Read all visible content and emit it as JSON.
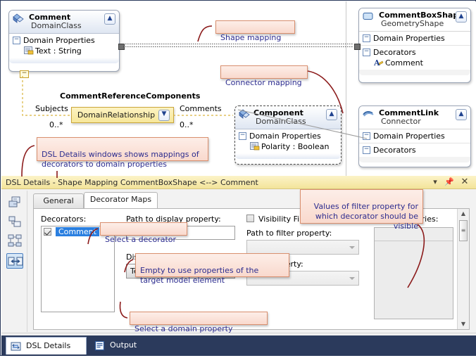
{
  "diagram": {
    "nodes": [
      {
        "id": "comment",
        "title": "Comment",
        "subtitle": "DomainClass",
        "icon": "domain-class-icon",
        "compartments": [
          {
            "label": "Domain Properties",
            "items": [
              "Text : String"
            ]
          }
        ]
      },
      {
        "id": "component",
        "title": "Component",
        "subtitle": "DomainClass",
        "icon": "domain-class-icon",
        "compartments": [
          {
            "label": "Domain Properties",
            "items": [
              "Polarity : Boolean"
            ]
          }
        ]
      },
      {
        "id": "commentboxshape",
        "title": "CommentBoxShape",
        "subtitle": "GeometryShape",
        "icon": "geometry-shape-icon",
        "compartments": [
          {
            "label": "Domain Properties",
            "items": []
          },
          {
            "label": "Decorators",
            "items": [
              "Comment"
            ]
          }
        ]
      },
      {
        "id": "commentlink",
        "title": "CommentLink",
        "subtitle": "Connector",
        "icon": "connector-icon",
        "compartments": [
          {
            "label": "Domain Properties",
            "items": []
          },
          {
            "label": "Decorators",
            "items": []
          }
        ]
      }
    ],
    "relationship": {
      "name": "CommentReferenceComponents",
      "pill_label": "DomainRelationship",
      "source_role": "Subjects",
      "source_multiplicity": "0..*",
      "target_role": "Comments",
      "target_multiplicity": "0..*"
    },
    "callouts": [
      {
        "id": "shape-mapping",
        "text": "Shape mapping"
      },
      {
        "id": "connector-mapping",
        "text": "Connector mapping"
      },
      {
        "id": "dsl-details-note",
        "text": "DSL Details windows shows mappings of\ndecorators to domain properties"
      }
    ]
  },
  "dsl_details": {
    "title": "DSL Details - Shape Mapping CommentBoxShape <--> Comment",
    "title_buttons": [
      "dropdown",
      "pin",
      "close"
    ],
    "toolbar_icons": [
      "class-mapping-icon",
      "element-merge-icon",
      "diagram-mapping-icon",
      "shape-map-icon"
    ],
    "tabs": [
      {
        "label": "General",
        "active": false
      },
      {
        "label": "Decorator Maps",
        "active": true
      }
    ],
    "decorators_label": "Decorators:",
    "decorators": [
      {
        "label": "Comment",
        "checked": true,
        "selected": true
      }
    ],
    "path_to_display_label": "Path to display property:",
    "path_to_display_value": "",
    "display_property_label": "Display property:",
    "display_property_value": "Text",
    "visibility_filter_label": "Visibility Filter",
    "visibility_filter_checked": false,
    "path_to_filter_label": "Path to filter property:",
    "path_to_filter_value": "",
    "filter_property_label": "Filter property:",
    "filter_property_value": "",
    "visibility_entries_label": "Visibility entries:",
    "callouts": [
      {
        "id": "select-decorator",
        "text": "Select a decorator"
      },
      {
        "id": "empty-to-use",
        "text": "Empty to use properties of the\ntarget model element"
      },
      {
        "id": "select-domain-property",
        "text": "Select a domain property"
      },
      {
        "id": "filter-values",
        "text": "Values of filter property for\nwhich decorator should be\nvisible"
      }
    ]
  },
  "bottom_tabs": [
    {
      "label": "DSL Details",
      "icon": "dsl-details-icon",
      "active": true
    },
    {
      "label": "Output",
      "icon": "output-icon",
      "active": false
    }
  ],
  "colors": {
    "callout_text": "#2c2c8f",
    "callout_bg": "#fbe4da",
    "callout_border": "#d98f6e",
    "leader_line": "#8b1a1a",
    "title_bar": "#f5e7a6",
    "bottom_bar": "#2b3a5c",
    "selection": "#2a7fe0"
  }
}
